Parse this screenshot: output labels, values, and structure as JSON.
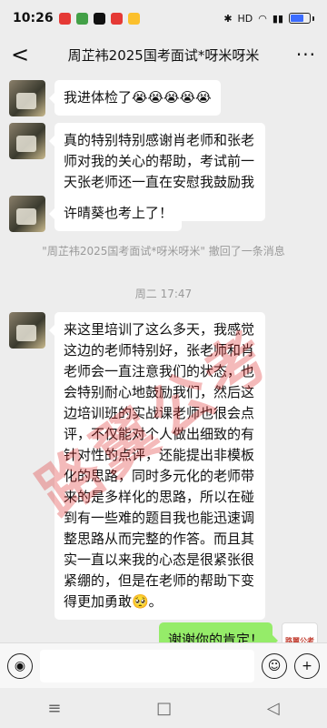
{
  "status_bar": {
    "time": "10:26",
    "battery_percent": 70,
    "network_label": "HD"
  },
  "header": {
    "title": "周芷袆2025国考面试*呀米呀米"
  },
  "messages": [
    {
      "text": "我进体检了😭😭😭😭😭"
    },
    {
      "text": "真的特别特别感谢肖老师和张老师对我的关心的帮助，考试前一天张老师还一直在安慰我鼓励我😭"
    },
    {
      "text": "许晴葵也考上了！"
    }
  ],
  "recall_notice": "\"周芷袆2025国考面试*呀米呀米\" 撤回了一条消息",
  "time_divider": "周二 17:47",
  "long_message": {
    "text": "来这里培训了这么多天，我感觉这边的老师特别好，张老师和肖老师会一直注意我们的状态，也会特别耐心地鼓励我们，然后这边培训班的实战课老师也很会点评，不仅能对个人做出细致的有针对性的点评，还能提出非模板化的思路，同时多元化的老师带来的是多样化的思路，所以在碰到有一些难的题目我也能迅速调整思路从而完整的作答。而且其实一直以来我的心态是很紧张很紧绷的，但是在老师的帮助下变得更加勇敢🥺。"
  },
  "my_message": {
    "text": "谢谢你的肯定！"
  },
  "my_avatar_label": "路翼公考",
  "watermark": "路翼公考",
  "input_bar": {
    "voice_icon": "voice-icon",
    "emoji_icon": "emoji-icon",
    "plus_icon": "plus-icon"
  }
}
